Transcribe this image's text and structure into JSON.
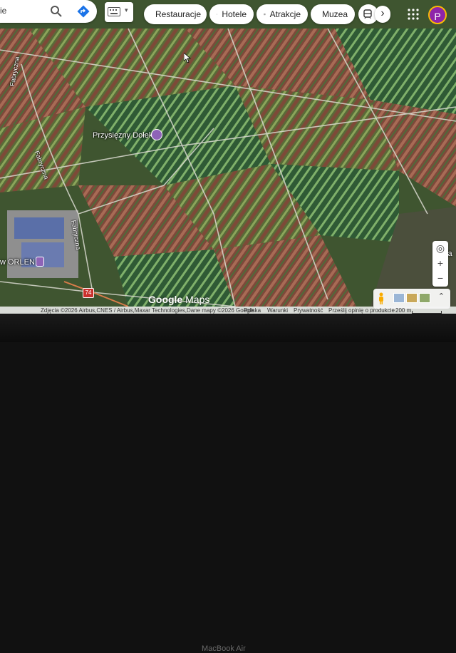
{
  "search": {
    "partial_text": "ie"
  },
  "categories": [
    {
      "label": "Restauracje",
      "icon": "fork-knife-icon"
    },
    {
      "label": "Hotele",
      "icon": "bed-icon"
    },
    {
      "label": "Atrakcje",
      "icon": "camera-icon"
    },
    {
      "label": "Muzea",
      "icon": "museum-icon"
    }
  ],
  "avatar_letter": "P",
  "map_labels": {
    "poi": "Przysięzny Dołek",
    "orlen": "w ORLEN",
    "road_fabryczna_1": "Fabryczna",
    "road_fabryczna_2": "Fabryczna",
    "road_fabryczna_3": "Fabryczna",
    "route_74": "74",
    "edge_text": "ała"
  },
  "logo": {
    "google": "Google",
    "maps": "Maps"
  },
  "footer": {
    "attribution": "Zdjęcia ©2026 Airbus,CNES / Airbus,Maxar Technologies,Dane mapy ©2026 Google",
    "country": "Polska",
    "terms": "Warunki",
    "privacy": "Prywatność",
    "feedback": "Prześlij opinię o produkcie",
    "scale": "200 m"
  },
  "laptop": {
    "brand": "MacBook Air"
  },
  "colors": {
    "accent_blue": "#1a73e8",
    "poi_purple": "#8e63b7",
    "avatar": "#8e24aa"
  }
}
